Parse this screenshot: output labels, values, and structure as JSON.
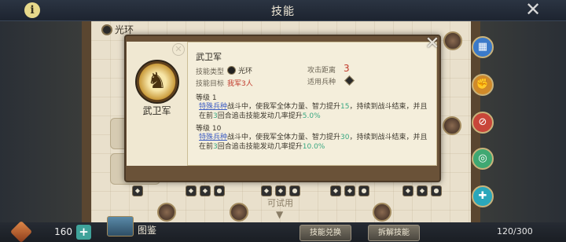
{
  "header": {
    "title": "技能",
    "info_icon": "info-icon",
    "close_icon": "close-icon"
  },
  "category": {
    "label": "光环"
  },
  "background": {
    "try_label": "可试用"
  },
  "popup": {
    "skill_name": "武卫军",
    "title": "武卫军",
    "type_label": "技能类型",
    "type_value": "光环",
    "range_label": "攻击距离",
    "range_value": "3",
    "target_label": "技能目标",
    "target_value": "我军3人",
    "unit_label": "适用兵种",
    "levels": [
      {
        "label": "等级 1",
        "link": "特殊兵种",
        "text_a": "战斗中，使我军全体力量、智力提升",
        "num_a": "15",
        "text_b": "，持续到战斗结束，并且在前",
        "num_b": "3",
        "text_c": "回合追击技能发动几率提升",
        "num_c": "5.0%"
      },
      {
        "label": "等级 10",
        "link": "特殊兵种",
        "text_a": "战斗中，使我军全体力量、智力提升",
        "num_a": "30",
        "text_b": "，持续到战斗结束，并且在前",
        "num_b": "3",
        "text_c": "回合追击技能发动几率提升",
        "num_c": "10.0%"
      }
    ],
    "colors": {
      "link": "#3f5fc4",
      "number": "#3aa882",
      "target": "#c0392b",
      "range": "#c0392b"
    }
  },
  "bottom": {
    "gem_count": "160",
    "book_label": "图鉴",
    "exchange_button": "技能兑换",
    "dismantle_button": "拆解技能",
    "capacity": "120/300"
  }
}
